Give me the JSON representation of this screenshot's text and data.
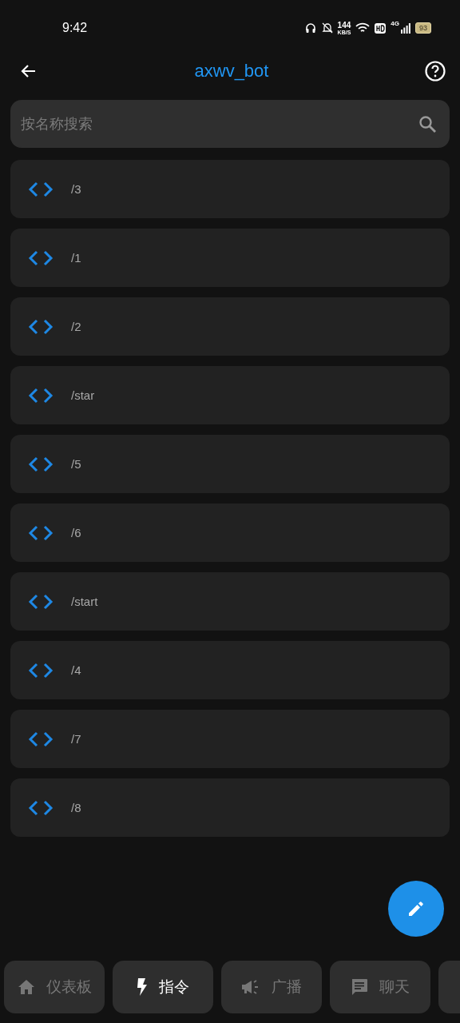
{
  "status_bar": {
    "time": "9:42",
    "speed": "144",
    "speed_unit": "KB/S",
    "network": "4G",
    "battery": "93"
  },
  "header": {
    "title": "axwv_bot"
  },
  "search": {
    "placeholder": "按名称搜索"
  },
  "commands": [
    {
      "label": "/3"
    },
    {
      "label": "/1"
    },
    {
      "label": "/2"
    },
    {
      "label": "/star"
    },
    {
      "label": "/5"
    },
    {
      "label": "/6"
    },
    {
      "label": "/start"
    },
    {
      "label": "/4"
    },
    {
      "label": "/7"
    },
    {
      "label": "/8"
    }
  ],
  "nav_tabs": [
    {
      "label": "仪表板",
      "kind": "home",
      "selected": false
    },
    {
      "label": "指令",
      "kind": "bolt",
      "selected": true
    },
    {
      "label": "广播",
      "kind": "megaphone",
      "selected": false
    },
    {
      "label": "聊天",
      "kind": "chat",
      "selected": false
    },
    {
      "kind": "blank"
    }
  ]
}
